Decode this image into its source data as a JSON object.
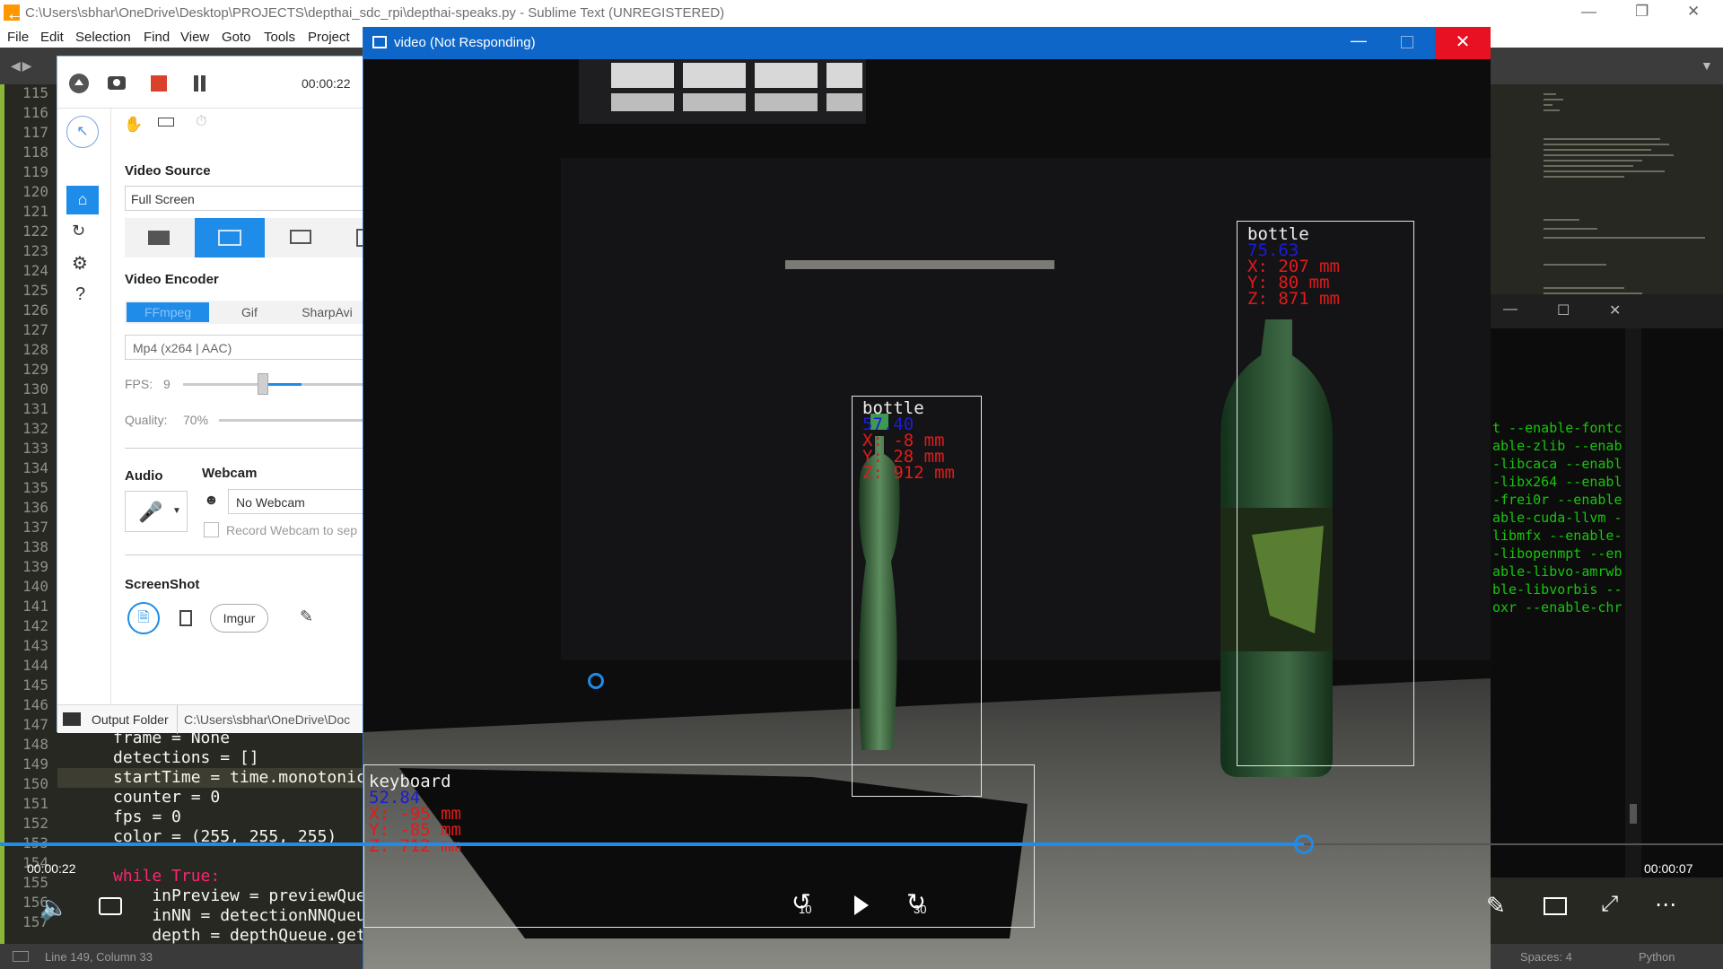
{
  "sublime": {
    "title": "C:\\Users\\sbhar\\OneDrive\\Desktop\\PROJECTS\\depthai_sdc_rpi\\depthai-speaks.py - Sublime Text (UNREGISTERED)",
    "menu": [
      "File",
      "Edit",
      "Selection",
      "Find",
      "View",
      "Goto",
      "Tools",
      "Project"
    ],
    "line_numbers": [
      "115",
      "116",
      "117",
      "118",
      "119",
      "120",
      "121",
      "122",
      "123",
      "124",
      "125",
      "126",
      "127",
      "128",
      "129",
      "130",
      "131",
      "132",
      "133",
      "134",
      "135",
      "136",
      "137",
      "138",
      "139",
      "140",
      "141",
      "142",
      "143",
      "144",
      "145",
      "146",
      "147",
      "148",
      "149",
      "150",
      "151",
      "152",
      "153",
      "154",
      "155",
      "156",
      "157"
    ],
    "code": {
      "l147": "frame = None",
      "l148": "detections = []",
      "l149": "startTime = time.monotonic(",
      "l150": "counter = 0",
      "l151": "fps = 0",
      "l152": "color = (255, 255, 255)",
      "l154": "while True:",
      "l155": "    inPreview = previewQueu",
      "l156": "    inNN = detectionNNQueue",
      "l157": "    depth = depthQueue.get("
    },
    "status": {
      "position": "Line 149, Column 33",
      "spaces": "Spaces: 4",
      "syntax": "Python"
    }
  },
  "terminal": {
    "lines": [
      "t --enable-fontc",
      "able-zlib --enab",
      "-libcaca --enabl",
      "-libx264 --enabl",
      "-frei0r --enable",
      "able-cuda-llvm -",
      "libmfx --enable-",
      "-libopenmpt --en",
      "able-libvo-amrwb",
      "ble-libvorbis --",
      "oxr --enable-chr"
    ]
  },
  "captura": {
    "elapsed": "00:00:22",
    "video_source_label": "Video Source",
    "video_source_value": "Full Screen",
    "video_encoder_label": "Video Encoder",
    "encoder_tabs": [
      "FFmpeg",
      "Gif",
      "SharpAvi"
    ],
    "encoder_value": "Mp4 (x264 | AAC)",
    "fps_label": "FPS:",
    "fps_value": "9",
    "quality_label": "Quality:",
    "quality_value": "70%",
    "audio_label": "Audio",
    "webcam_label": "Webcam",
    "webcam_value": "No Webcam",
    "record_webcam_label": "Record Webcam to sep",
    "screenshot_label": "ScreenShot",
    "imgur_label": "Imgur",
    "output_folder_label": "Output Folder",
    "output_folder_path": "C:\\Users\\sbhar\\OneDrive\\Doc"
  },
  "video_window": {
    "title": "video (Not Responding)"
  },
  "detections": [
    {
      "label": "bottle",
      "confidence": "75.63",
      "x": "X: 207 mm",
      "y": "Y: 80 mm",
      "z": "Z: 871 mm"
    },
    {
      "label": "bottle",
      "confidence": "57.40",
      "x": "X: -8 mm",
      "y": "Y: 28 mm",
      "z": "Z: 912 mm"
    },
    {
      "label": "keyboard",
      "confidence": "52.84",
      "x": "X: -95 mm",
      "y": "Y: -85 mm",
      "z": "Z: 712 mm"
    }
  ],
  "player": {
    "elapsed": "00:00:22",
    "remaining": "00:00:07",
    "rewind_seconds": "10",
    "forward_seconds": "30",
    "progress": 0.757
  },
  "colors": {
    "accent": "#0e66c9",
    "close_red": "#e81123",
    "terminal_green": "#16c60c",
    "gutter_green": "#8ab536",
    "detect_red": "#e11b1b",
    "detect_blue": "#1c1cd6"
  }
}
